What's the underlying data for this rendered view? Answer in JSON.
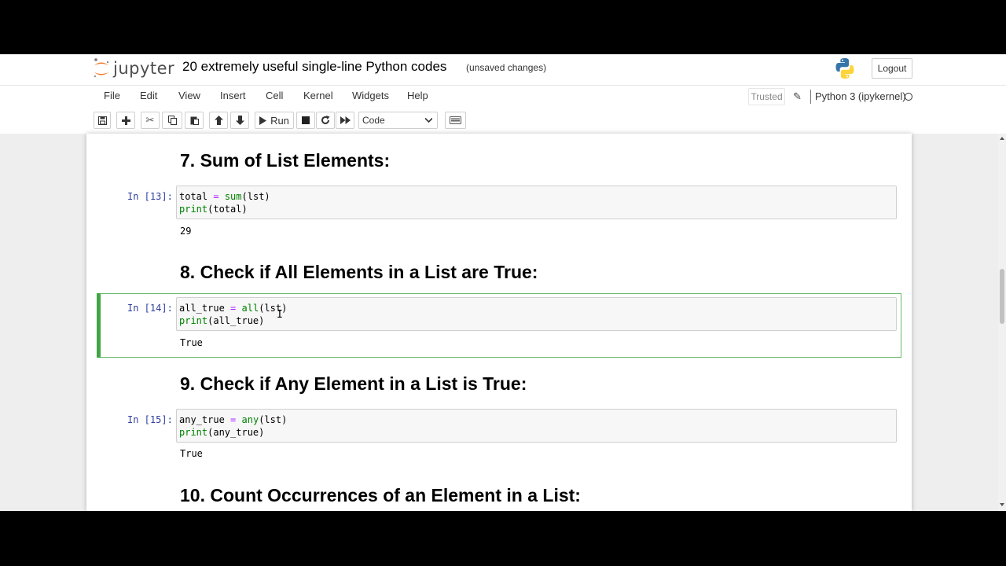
{
  "header": {
    "logo_text": "jupyter",
    "notebook_title": "20 extremely useful single-line Python codes",
    "autosave_status": "(unsaved changes)",
    "logout_label": "Logout"
  },
  "menubar": {
    "items": [
      "File",
      "Edit",
      "View",
      "Insert",
      "Cell",
      "Kernel",
      "Widgets",
      "Help"
    ],
    "trusted_label": "Trusted",
    "kernel_name": "Python 3 (ipykernel)"
  },
  "toolbar": {
    "run_label": "Run",
    "cell_type": "Code"
  },
  "cells": [
    {
      "heading": "7. Sum of List Elements:",
      "prompt": "In [13]:",
      "code": [
        "total = sum(lst)",
        "print(total)"
      ],
      "output": "29"
    },
    {
      "heading": "8. Check if All Elements in a List are True:",
      "prompt": "In [14]:",
      "code": [
        "all_true = all(lst)",
        "print(all_true)"
      ],
      "output": "True"
    },
    {
      "heading": "9. Check if Any Element in a List is True:",
      "prompt": "In [15]:",
      "code": [
        "any_true = any(lst)",
        "print(any_true)"
      ],
      "output": "True"
    },
    {
      "heading": "10. Count Occurrences of an Element in a List:"
    }
  ],
  "colors": {
    "prompt": "#303f9f",
    "selected_border": "#66bb6a",
    "builtin": "#008000",
    "operator": "#aa22ff"
  },
  "icons": [
    "save-icon",
    "plus-icon",
    "scissors-icon",
    "copy-icon",
    "paste-icon",
    "arrow-up-icon",
    "arrow-down-icon",
    "play-icon",
    "stop-icon",
    "restart-icon",
    "fast-forward-icon",
    "keyboard-icon",
    "pencil-icon",
    "python-logo-icon"
  ]
}
